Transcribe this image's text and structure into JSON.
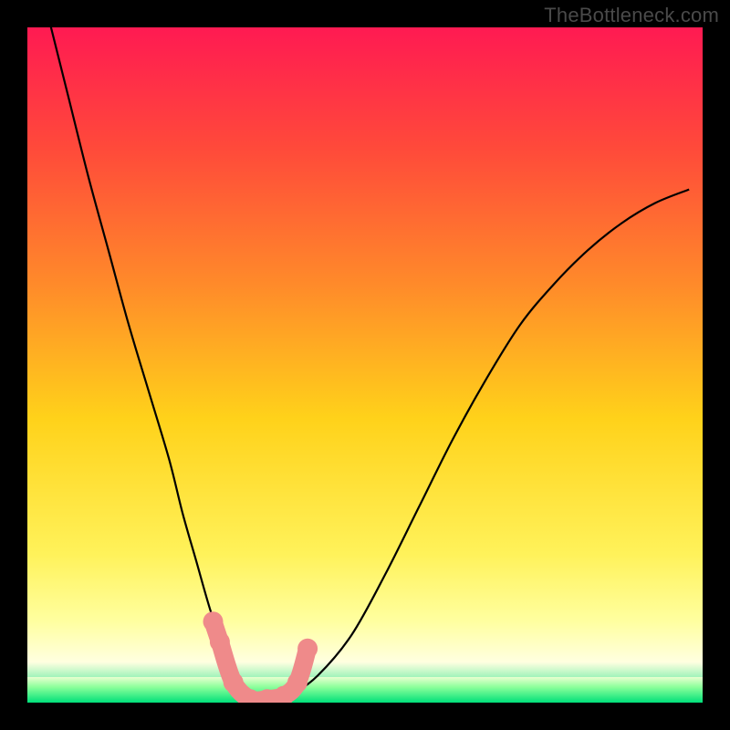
{
  "watermark": "TheBottleneck.com",
  "colors": {
    "curve": "#000000",
    "marker_fill": "#ef8a8a",
    "marker_stroke": "#d86a6a",
    "gradient_stops": [
      "#ff1a52",
      "#ff4a3a",
      "#ff8a2a",
      "#ffd21a",
      "#fff25a",
      "#ffffa0",
      "#ffffe0",
      "#00e07a"
    ]
  },
  "chart_data": {
    "type": "line",
    "title": "",
    "xlabel": "",
    "ylabel": "",
    "xlim": [
      0,
      100
    ],
    "ylim": [
      0,
      100
    ],
    "series": [
      {
        "name": "bottleneck-curve",
        "x": [
          3,
          6,
          9,
          12,
          15,
          18,
          21,
          23,
          25,
          27,
          29,
          31,
          33,
          35,
          37,
          39,
          43,
          48,
          53,
          58,
          63,
          68,
          73,
          78,
          83,
          88,
          93,
          98
        ],
        "values": [
          102,
          90,
          78,
          67,
          56,
          46,
          36,
          28,
          21,
          14,
          8,
          3,
          1,
          0,
          0,
          1,
          4,
          10,
          19,
          29,
          39,
          48,
          56,
          62,
          67,
          71,
          74,
          76
        ]
      }
    ],
    "markers": {
      "name": "highlighted-points",
      "x": [
        27.5,
        28.5,
        30.5,
        33,
        35.5,
        38,
        40,
        41.5
      ],
      "values": [
        12,
        9,
        3,
        0.5,
        0.5,
        1,
        3,
        8
      ]
    }
  }
}
